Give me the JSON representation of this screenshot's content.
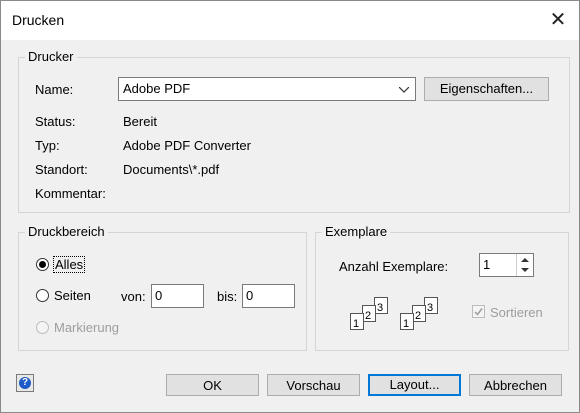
{
  "window": {
    "title": "Drucken"
  },
  "printer": {
    "legend": "Drucker",
    "name_label": "Name:",
    "name_value": "Adobe PDF",
    "properties_button": "Eigenschaften...",
    "status_label": "Status:",
    "status_value": "Bereit",
    "type_label": "Typ:",
    "type_value": "Adobe PDF Converter",
    "location_label": "Standort:",
    "location_value": "Documents\\*.pdf",
    "comment_label": "Kommentar:"
  },
  "range": {
    "legend": "Druckbereich",
    "all_label": "Alles",
    "pages_label": "Seiten",
    "from_label": "von:",
    "from_value": "0",
    "to_label": "bis:",
    "to_value": "0",
    "selection_label": "Markierung",
    "selected": "Alles"
  },
  "copies": {
    "legend": "Exemplare",
    "count_label": "Anzahl Exemplare:",
    "count_value": "1",
    "collate_label": "Sortieren",
    "collate_checked": true,
    "collate_enabled": false,
    "page_numbers": [
      "1",
      "2",
      "3"
    ]
  },
  "buttons": {
    "ok": "OK",
    "preview": "Vorschau",
    "layout": "Layout...",
    "cancel": "Abbrechen"
  },
  "icons": {
    "help": "help-icon",
    "close": "close-icon"
  }
}
